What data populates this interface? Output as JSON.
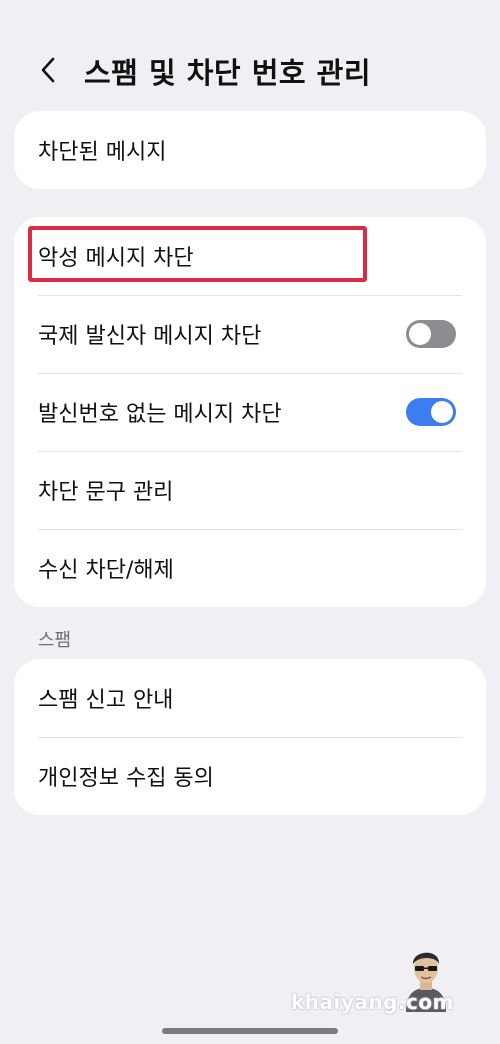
{
  "header": {
    "title": "스팸 및 차단 번호 관리",
    "back_icon": "chevron-left-icon"
  },
  "card1": {
    "items": [
      {
        "label": "차단된 메시지"
      }
    ]
  },
  "card2": {
    "items": [
      {
        "label": "악성 메시지 차단"
      },
      {
        "label": "국제 발신자 메시지 차단",
        "toggle": "off"
      },
      {
        "label": "발신번호 없는 메시지 차단",
        "toggle": "on"
      },
      {
        "label": "차단 문구 관리"
      },
      {
        "label": "수신 차단/해제"
      }
    ]
  },
  "spam_section": {
    "label": "스팸",
    "items": [
      {
        "label": "스팸 신고 안내"
      },
      {
        "label": "개인정보 수집 동의"
      }
    ]
  },
  "watermark": "khaiyang.com",
  "colors": {
    "background": "#efeff4",
    "card": "#ffffff",
    "toggle_on": "#3e7cf2",
    "toggle_off": "#8c8c91",
    "highlight": "#dc2c45"
  }
}
